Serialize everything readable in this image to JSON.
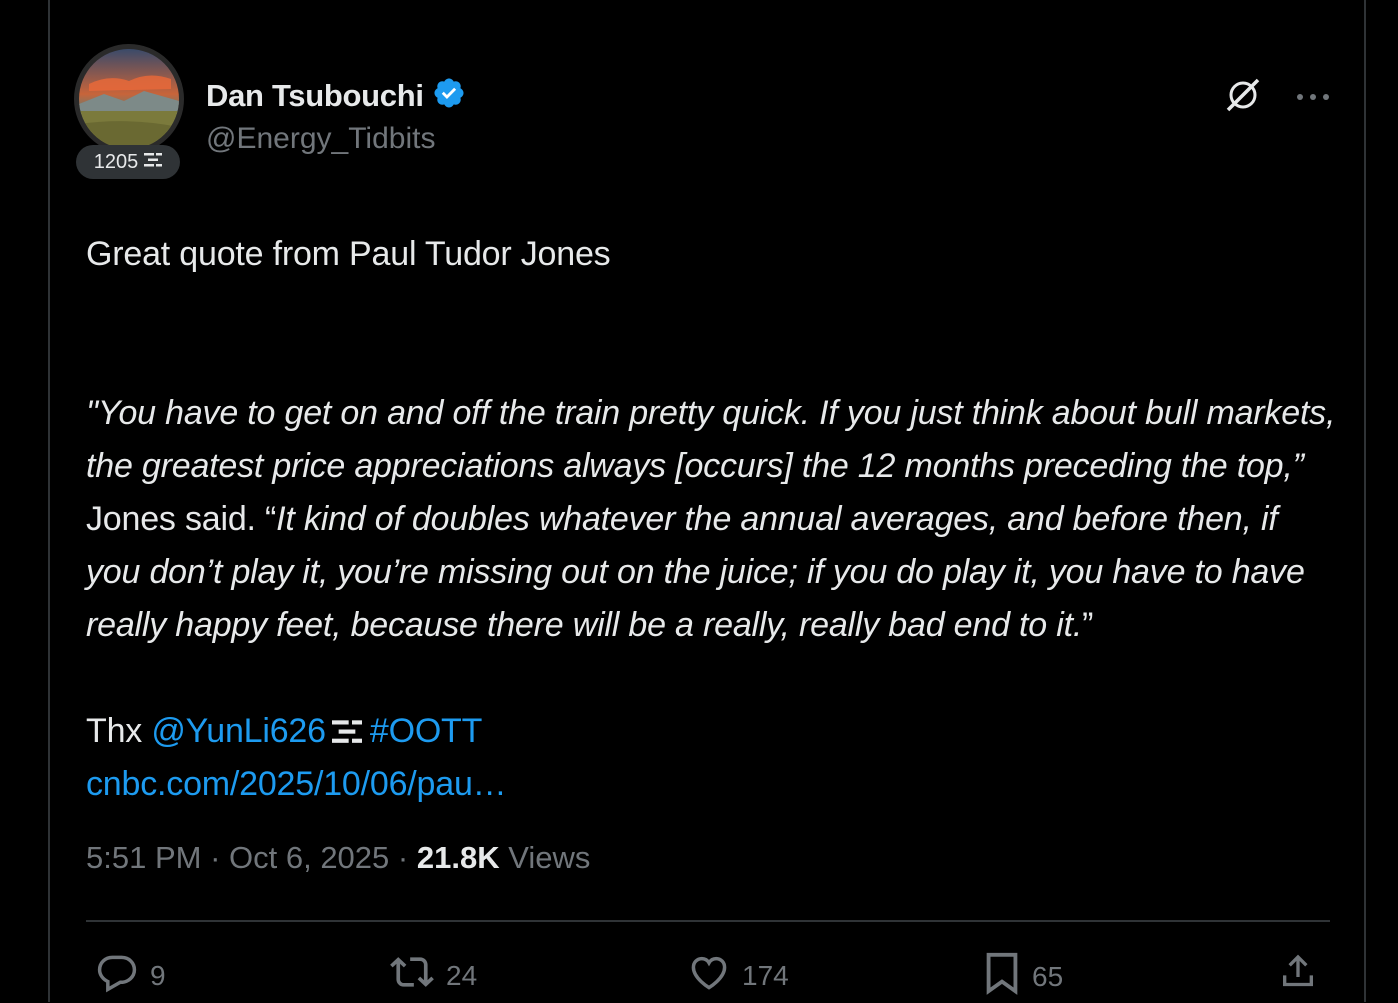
{
  "author": {
    "name": "Dan Tsubouchi",
    "handle": "@Energy_Tidbits",
    "badge_count": "1205",
    "verified_icon": "verified-badge-icon",
    "verified_color": "#1d9bf0"
  },
  "tweet": {
    "line1": "Great quote from Paul Tudor Jones",
    "quote_italic_1": "\"You have to get on and off the train pretty quick. If you just think about bull markets, the greatest price appreciations always [occurs] the 12 months preceding the top,”",
    "quote_plain": " Jones said. “",
    "quote_italic_2": "It kind of doubles whatever the annual averages, and before then, if you don’t play it, you’re missing out on the juice; if you do play it, you have to have really happy feet, because there will be a really, really bad end to it.",
    "quote_end": "”",
    "thx": "Thx ",
    "mention": "@YunLi626",
    "hashtag": "#OOTT",
    "url": "cnbc.com/2025/10/06/pau…"
  },
  "meta": {
    "time": "5:51 PM",
    "sep": " · ",
    "date": "Oct 6, 2025",
    "views_count": "21.8K",
    "views_label": " Views"
  },
  "actions": {
    "replies": "9",
    "reposts": "24",
    "likes": "174",
    "bookmarks": "65"
  },
  "colors": {
    "background": "#000000",
    "text": "#e7e9ea",
    "muted": "#71767b",
    "link": "#1d9bf0",
    "border": "#2f3336"
  }
}
